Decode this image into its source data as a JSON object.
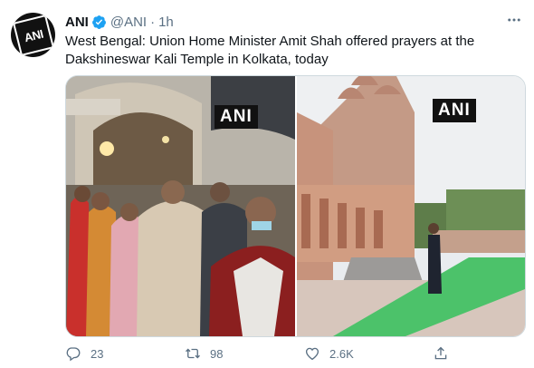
{
  "tweet": {
    "author_name": "ANI",
    "handle": "@ANI",
    "separator": "·",
    "time": "1h",
    "avatar_text": "ANI",
    "text": "West Bengal: Union Home Minister Amit Shah offered prayers at the Dakshineswar Kali Temple in Kolkata, today"
  },
  "media": {
    "left_watermark": "ANI",
    "right_watermark": "ANI"
  },
  "actions": {
    "reply_count": "23",
    "retweet_count": "98",
    "like_count": "2.6K"
  },
  "colors": {
    "verified": "#1da1f2",
    "secondary_text": "#5b7083",
    "border": "#cfd9de",
    "grass": "#4cc26a"
  },
  "icons": [
    "verified-badge-icon",
    "more-icon",
    "reply-icon",
    "retweet-icon",
    "like-icon",
    "share-icon"
  ]
}
